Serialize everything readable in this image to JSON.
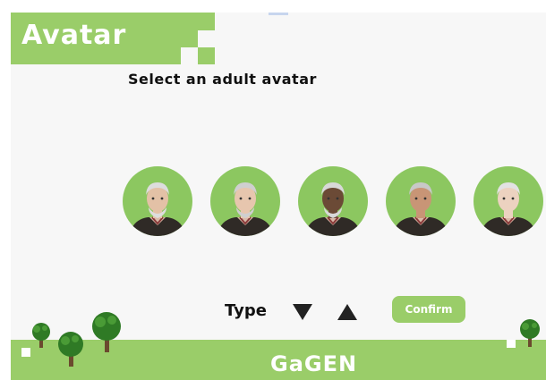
{
  "header": {
    "title": "Avatar"
  },
  "main": {
    "subtitle": "Select an adult avatar"
  },
  "avatars": [
    {
      "label": "avatar-1",
      "skin": "#e3c1a6",
      "hair": "#dddddd",
      "beard": true
    },
    {
      "label": "avatar-2",
      "skin": "#e7c6ae",
      "hair": "#cfcfcf",
      "beard": true
    },
    {
      "label": "avatar-3",
      "skin": "#6b4a36",
      "hair": "#d8d8d8",
      "beard": true
    },
    {
      "label": "avatar-4",
      "skin": "#c89576",
      "hair": "#c8c8c8",
      "beard": false
    },
    {
      "label": "avatar-5",
      "skin": "#ecd2c0",
      "hair": "#e2e2e2",
      "beard": false
    }
  ],
  "controls": {
    "type_label": "Type",
    "confirm_label": "Confirm"
  },
  "footer": {
    "brand": "GaGEN"
  },
  "colors": {
    "brand_green": "#9acd69",
    "avatar_bg": "#8cc760",
    "text": "#111111"
  }
}
